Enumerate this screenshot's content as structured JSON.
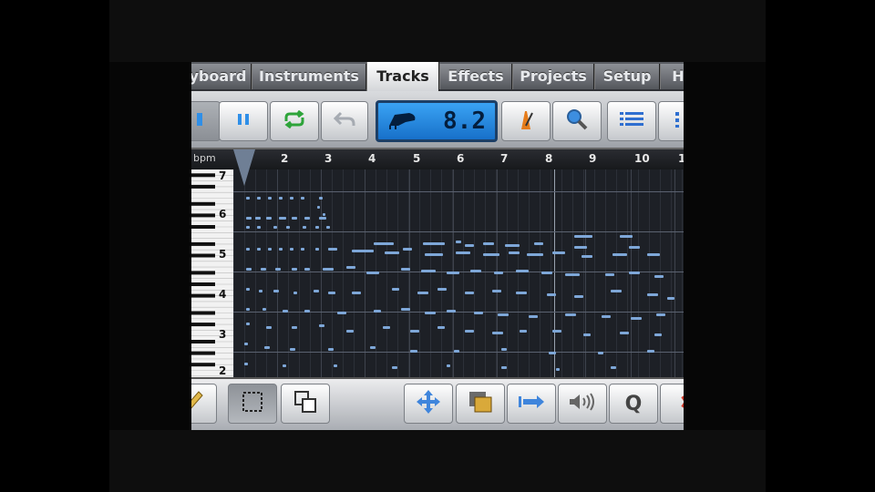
{
  "tabs": [
    {
      "label": "yboard",
      "active": false
    },
    {
      "label": "Instruments",
      "active": false
    },
    {
      "label": "Tracks",
      "active": true
    },
    {
      "label": "Effects",
      "active": false
    },
    {
      "label": "Projects",
      "active": false
    },
    {
      "label": "Setup",
      "active": false
    },
    {
      "label": "H",
      "active": false
    }
  ],
  "toolbar": {
    "position_display": "8.2",
    "icons": [
      "record-icon",
      "pause-icon",
      "loop-icon",
      "undo-icon",
      "piano-icon",
      "metronome-icon",
      "zoom-icon",
      "track-list-icon",
      "mixer-icon"
    ]
  },
  "ruler": {
    "bpm_label": "bpm",
    "bars": [
      "1",
      "2",
      "3",
      "4",
      "5",
      "6",
      "7",
      "8",
      "9",
      "10",
      "1"
    ]
  },
  "octaves": [
    "7",
    "6",
    "5",
    "4",
    "3",
    "2"
  ],
  "bottom_toolbar": {
    "quantize_label": "Q",
    "icons": [
      "pencil-icon",
      "select-box-icon",
      "copy-icon",
      "move-icon",
      "paste-icon",
      "stretch-icon",
      "velocity-icon",
      "quantize-icon",
      "delete-icon"
    ]
  },
  "colors": {
    "accent": "#2f8fe8",
    "note": "#7ea7d8",
    "loop": "#2ea43a"
  }
}
